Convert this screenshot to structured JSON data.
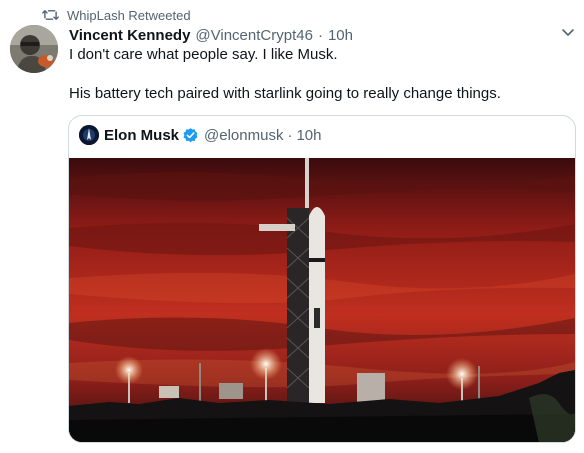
{
  "retweet": {
    "label": "WhipLash Retweeted",
    "icon": "retweet-icon"
  },
  "tweet": {
    "author_name": "Vincent Kennedy",
    "author_handle": "@VincentCrypt46",
    "separator": "·",
    "time": "10h",
    "text_line_1": "I don't care what people say. I like Musk.",
    "text_line_2": "His battery tech paired with starlink going to really change things."
  },
  "quoted_tweet": {
    "author_name": "Elon Musk",
    "verified": true,
    "author_handle": "@elonmusk",
    "separator": "·",
    "time": "10h"
  },
  "colors": {
    "text_primary": "#0f1419",
    "text_secondary": "#536471",
    "verified_blue": "#1d9bf0",
    "border": "#cfd9de",
    "sky_red": "#b3241b"
  },
  "icons": [
    "retweet-icon",
    "chevron-down-icon",
    "verified-badge-icon"
  ]
}
